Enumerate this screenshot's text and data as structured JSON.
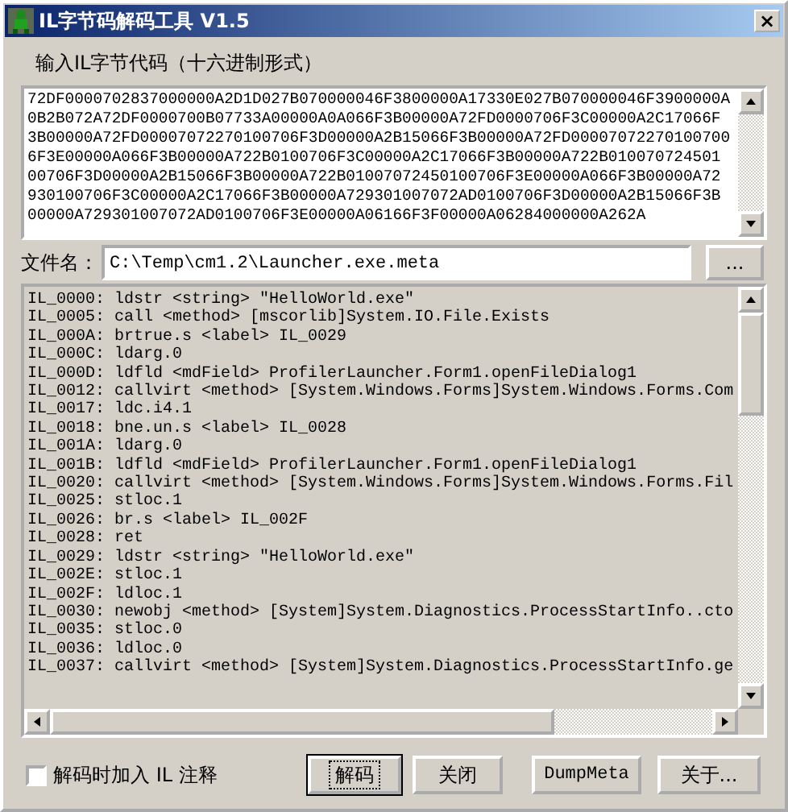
{
  "window": {
    "title": "IL字节码解码工具 V1.5",
    "close": "×"
  },
  "hex_input": {
    "label": "输入IL字节代码（十六进制形式）",
    "lines": [
      "72DF0000702837000000A2D1D027B070000046F3800000A17330E027B070000046F3900000A",
      "0B2B072A72DF0000700B07733A00000A0A066F3B00000A72FD0000706F3C00000A2C17066F",
      "3B00000A72FD00007072270100706F3D00000A2B15066F3B00000A72FD00007072270100700",
      "6F3E00000A066F3B00000A722B0100706F3C00000A2C17066F3B00000A722B010070724501",
      "00706F3D00000A2B15066F3B00000A722B01007072450100706F3E00000A066F3B00000A72",
      "930100706F3C00000A2C17066F3B00000A729301007072AD0100706F3D00000A2B15066F3B",
      "00000A729301007072AD0100706F3E00000A06166F3F00000A06284000000A262A"
    ]
  },
  "file": {
    "label": "文件名：",
    "value": "C:\\Temp\\cm1.2\\Launcher.exe.meta",
    "browse": "..."
  },
  "listing": [
    "IL_0000: ldstr <string> \"HelloWorld.exe\"",
    "IL_0005: call <method> [mscorlib]System.IO.File.Exists",
    "IL_000A: brtrue.s <label> IL_0029",
    "IL_000C: ldarg.0",
    "IL_000D: ldfld <mdField> ProfilerLauncher.Form1.openFileDialog1",
    "IL_0012: callvirt <method> [System.Windows.Forms]System.Windows.Forms.Com",
    "IL_0017: ldc.i4.1",
    "IL_0018: bne.un.s <label> IL_0028",
    "IL_001A: ldarg.0",
    "IL_001B: ldfld <mdField> ProfilerLauncher.Form1.openFileDialog1",
    "IL_0020: callvirt <method> [System.Windows.Forms]System.Windows.Forms.Fil",
    "IL_0025: stloc.1",
    "IL_0026: br.s <label> IL_002F",
    "IL_0028: ret",
    "IL_0029: ldstr <string> \"HelloWorld.exe\"",
    "IL_002E: stloc.1",
    "IL_002F: ldloc.1",
    "IL_0030: newobj <method> [System]System.Diagnostics.ProcessStartInfo..cto",
    "IL_0035: stloc.0",
    "IL_0036: ldloc.0",
    "IL_0037: callvirt <method> [System]System.Diagnostics.ProcessStartInfo.ge"
  ],
  "comment_option": {
    "label": "解码时加入 IL 注释",
    "checked": false
  },
  "buttons": [
    {
      "label": "解码",
      "default": true
    },
    {
      "label": "关闭",
      "default": false
    },
    {
      "label": "DumpMeta",
      "default": false
    },
    {
      "label": "关于...",
      "default": false
    }
  ]
}
